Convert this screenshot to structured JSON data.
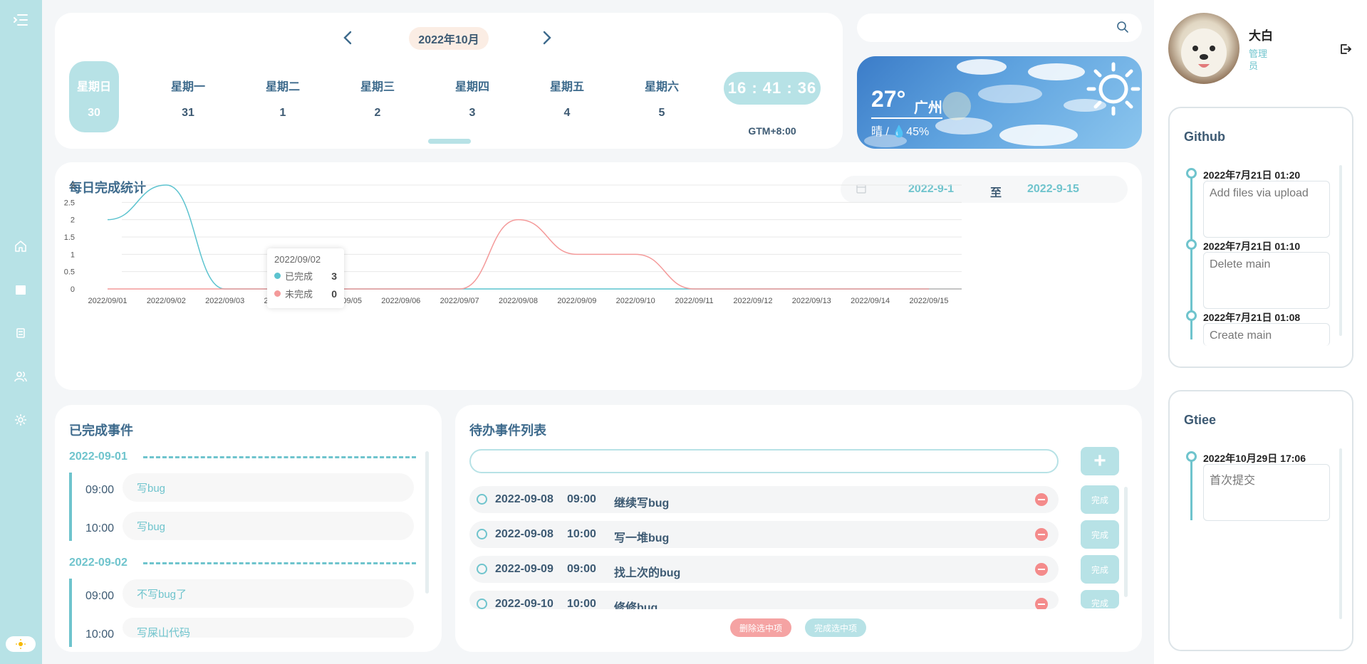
{
  "nav": {
    "items": [
      "menu-icon",
      "home-icon",
      "calendar-icon",
      "tasks-icon",
      "users-icon",
      "settings-icon"
    ],
    "theme_icon": "sun-icon"
  },
  "calendar": {
    "month": "2022年10月",
    "days": [
      {
        "name": "星期日",
        "date": "30",
        "active": true
      },
      {
        "name": "星期一",
        "date": "31"
      },
      {
        "name": "星期二",
        "date": "1"
      },
      {
        "name": "星期三",
        "date": "2"
      },
      {
        "name": "星期四",
        "date": "3"
      },
      {
        "name": "星期五",
        "date": "4"
      },
      {
        "name": "星期六",
        "date": "5"
      }
    ],
    "time": "16 : 41 : 36",
    "timezone": "GTM+8:00"
  },
  "search": {
    "placeholder": ""
  },
  "weather": {
    "temp": "27°",
    "city": "广州",
    "desc": "晴  /  💧45%"
  },
  "stats": {
    "title": "每日完成统计",
    "range_from": "2022-9-1",
    "range_sep": "至",
    "range_to": "2022-9-15",
    "tooltip": {
      "date": "2022/09/02",
      "done_label": "已完成",
      "done_value": "3",
      "undone_label": "未完成",
      "undone_value": "0"
    }
  },
  "chart_data": {
    "type": "line",
    "categories": [
      "2022/09/01",
      "2022/09/02",
      "2022/09/03",
      "2022/09/04",
      "2022/09/05",
      "2022/09/06",
      "2022/09/07",
      "2022/09/08",
      "2022/09/09",
      "2022/09/10",
      "2022/09/11",
      "2022/09/12",
      "2022/09/13",
      "2022/09/14",
      "2022/09/15"
    ],
    "series": [
      {
        "name": "已完成",
        "color": "#5cc3cf",
        "values": [
          2,
          3,
          0,
          0,
          0,
          0,
          0,
          0,
          0,
          0,
          0,
          0,
          0,
          0,
          0
        ]
      },
      {
        "name": "未完成",
        "color": "#f49a9a",
        "values": [
          0,
          0,
          0,
          0,
          0,
          0,
          0,
          2,
          1,
          1,
          0,
          0,
          0,
          0,
          0
        ]
      }
    ],
    "yticks": [
      "0",
      "0.5",
      "1",
      "1.5",
      "2",
      "2.5",
      "3"
    ],
    "ylim": [
      0,
      3
    ],
    "smooth": true,
    "grid": true
  },
  "done": {
    "title": "已完成事件",
    "groups": [
      {
        "date": "2022-09-01",
        "items": [
          {
            "time": "09:00",
            "text": "写bug"
          },
          {
            "time": "10:00",
            "text": "写bug"
          }
        ]
      },
      {
        "date": "2022-09-02",
        "items": [
          {
            "time": "09:00",
            "text": "不写bug了"
          },
          {
            "time": "10:00",
            "text": "写屎山代码"
          }
        ]
      }
    ]
  },
  "todo": {
    "title": "待办事件列表",
    "input_value": "",
    "add_label": "+",
    "items": [
      {
        "date": "2022-09-08",
        "time": "09:00",
        "text": "继续写bug",
        "done_label": "完成"
      },
      {
        "date": "2022-09-08",
        "time": "10:00",
        "text": "写一堆bug",
        "done_label": "完成"
      },
      {
        "date": "2022-09-09",
        "time": "09:00",
        "text": "找上次的bug",
        "done_label": "完成"
      },
      {
        "date": "2022-09-10",
        "time": "10:00",
        "text": "修修bug",
        "done_label": "完成"
      }
    ],
    "delete_selected": "删除选中项",
    "complete_selected": "完成选中项"
  },
  "user": {
    "name": "大白",
    "role": "管理员"
  },
  "github": {
    "title": "Github",
    "commits": [
      {
        "time": "2022年7月21日  01:20",
        "msg": "Add files via upload"
      },
      {
        "time": "2022年7月21日  01:10",
        "msg": "Delete main"
      },
      {
        "time": "2022年7月21日  01:08",
        "msg": "Create main"
      }
    ]
  },
  "gitee": {
    "title": "Gtiee",
    "commits": [
      {
        "time": "2022年10月29日  17:06",
        "msg": "首次提交"
      }
    ]
  }
}
